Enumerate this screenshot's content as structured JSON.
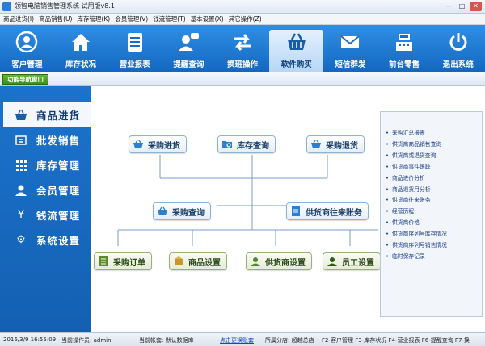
{
  "window": {
    "title": "领智电脑销售管理系统 试用版v8.1"
  },
  "menu": [
    "商品进货(I)",
    "商品销售(U)",
    "库存管理(K)",
    "会员管理(V)",
    "钱流管理(T)",
    "基本设置(X)",
    "其它操作(Z)"
  ],
  "toolbar": [
    {
      "label": "客户管理",
      "icon": "user-circle-icon"
    },
    {
      "label": "库存状况",
      "icon": "home-icon"
    },
    {
      "label": "营业报表",
      "icon": "report-list-icon"
    },
    {
      "label": "提醒查询",
      "icon": "user-chat-icon"
    },
    {
      "label": "换班操作",
      "icon": "swap-arrows-icon"
    },
    {
      "label": "软件购买",
      "icon": "shopping-basket-icon"
    },
    {
      "label": "短信群发",
      "icon": "envelope-icon"
    },
    {
      "label": "前台零售",
      "icon": "cash-register-icon"
    },
    {
      "label": "退出系统",
      "icon": "power-icon"
    }
  ],
  "nav": {
    "tab_label": "功能导航窗口"
  },
  "sidebar": [
    {
      "label": "商品进货",
      "icon": "basket-icon"
    },
    {
      "label": "批发销售",
      "icon": "receipt-icon"
    },
    {
      "label": "库存管理",
      "icon": "grid-icon"
    },
    {
      "label": "会员管理",
      "icon": "person-icon"
    },
    {
      "label": "钱流管理",
      "icon": "yen-icon"
    },
    {
      "label": "系统设置",
      "icon": "gear-icon"
    }
  ],
  "flow": {
    "purchase_in": "采购进货",
    "stock_query": "库存查询",
    "purchase_return": "采购退货",
    "purchase_query": "采购查询",
    "supplier_accounts": "供货商往来账务",
    "purchase_order": "采购订单",
    "product_settings": "商品设置",
    "supplier_settings": "供货商设置",
    "staff_settings": "员工设置"
  },
  "right_panel": [
    "采购汇总报表",
    "供货商商品销售查询",
    "供货商或退货查询",
    "供货商事件跟踪",
    "商品进价分析",
    "商品退货月分析",
    "供货商往来账务",
    "经营历程",
    "供货商价格",
    "供货商序列号库存情况",
    "供货商序列号销售情况",
    "临时保存记录"
  ],
  "status": {
    "datetime": "2016/3/9 16:55:09",
    "operator": "当前操作员: admin",
    "account": "当前帐套: 默认数据库",
    "change_account": "点击更换账套",
    "branch": "所属分店: 超越总店",
    "shortcuts": "F2-客户管理 F3-库存状况 F4-营业报表 F6-提醒查询 F7-换"
  },
  "colors": {
    "toolbar": "#1e7ad6",
    "sidebar": "#1a6cc4",
    "nav_tab": "#4a9c28"
  }
}
